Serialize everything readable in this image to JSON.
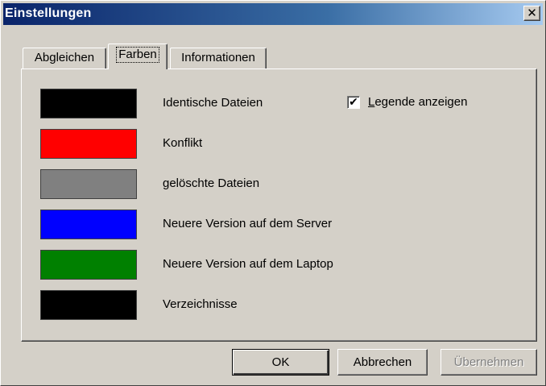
{
  "window": {
    "title": "Einstellungen",
    "close_glyph": "✕"
  },
  "tabs": [
    {
      "label": "Abgleichen",
      "active": false
    },
    {
      "label": "Farben",
      "active": true
    },
    {
      "label": "Informationen",
      "active": false
    }
  ],
  "colors": [
    {
      "label": "Identische Dateien",
      "color": "#000000"
    },
    {
      "label": "Konflikt",
      "color": "#ff0000"
    },
    {
      "label": "gelöschte Dateien",
      "color": "#808080"
    },
    {
      "label": "Neuere Version auf dem Server",
      "color": "#0000ff"
    },
    {
      "label": "Neuere Version auf dem Laptop",
      "color": "#008000"
    },
    {
      "label": "Verzeichnisse",
      "color": "#000000"
    }
  ],
  "legend_checkbox": {
    "mnemonic": "L",
    "label_rest": "egende anzeigen",
    "checked": true,
    "check_glyph": "✔"
  },
  "buttons": {
    "ok": "OK",
    "cancel": "Abbrechen",
    "apply": "Übernehmen"
  }
}
